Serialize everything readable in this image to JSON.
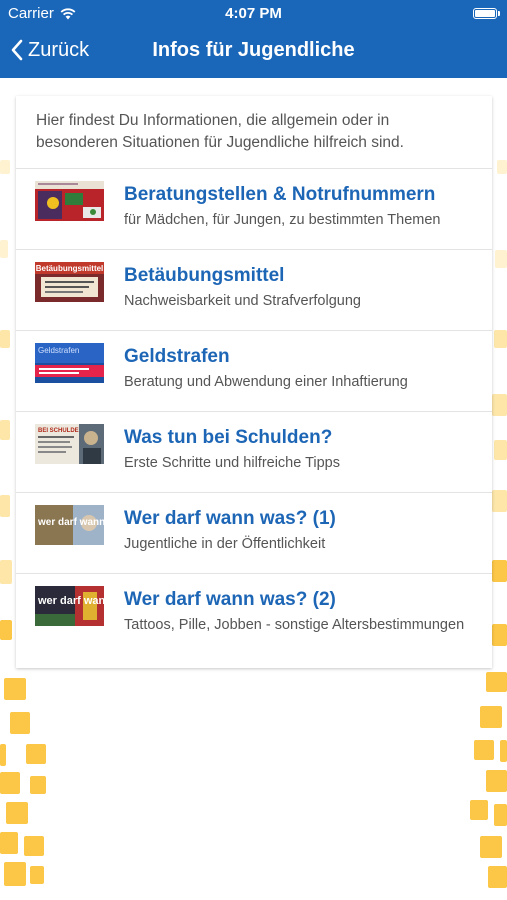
{
  "status_bar": {
    "carrier": "Carrier",
    "time": "4:07 PM"
  },
  "nav": {
    "back_label": "Zurück",
    "title": "Infos für Jugendliche"
  },
  "intro": "Hier findest Du Informationen, die allgemein oder in besonderen Situationen für Jugendliche hilfreich sind.",
  "items": [
    {
      "title": "Beratungstellen & Notrufnummern",
      "subtitle": "für Mädchen, für Jungen, zu bestimmten Themen",
      "thumb_text": "",
      "icon": "beratung-thumbnail"
    },
    {
      "title": "Betäubungsmittel",
      "subtitle": "Nachweisbarkeit und Strafverfolgung",
      "thumb_text": "Betäubungsmittel",
      "icon": "betaeubungsmittel-thumbnail"
    },
    {
      "title": "Geldstrafen",
      "subtitle": "Beratung und Abwendung einer Inhaftierung",
      "thumb_text": "Geldstrafen",
      "icon": "geldstrafen-thumbnail"
    },
    {
      "title": "Was tun bei Schulden?",
      "subtitle": "Erste Schritte und hilfreiche Tipps",
      "thumb_text": "BEI SCHULDEN",
      "icon": "schulden-thumbnail"
    },
    {
      "title": "Wer darf wann was? (1)",
      "subtitle": "Jugentliche in der Öffentlichkeit",
      "thumb_text": "wer darf wann",
      "icon": "werdarf1-thumbnail"
    },
    {
      "title": "Wer darf wann was? (2)",
      "subtitle": "Tattoos, Pille, Jobben - sonstige Altersbestimmungen",
      "thumb_text": "wer darf wann",
      "icon": "werdarf2-thumbnail"
    }
  ],
  "colors": {
    "nav_bg": "#1a66b8",
    "link": "#1d66b6",
    "accent_yellow": "#fcc646"
  }
}
